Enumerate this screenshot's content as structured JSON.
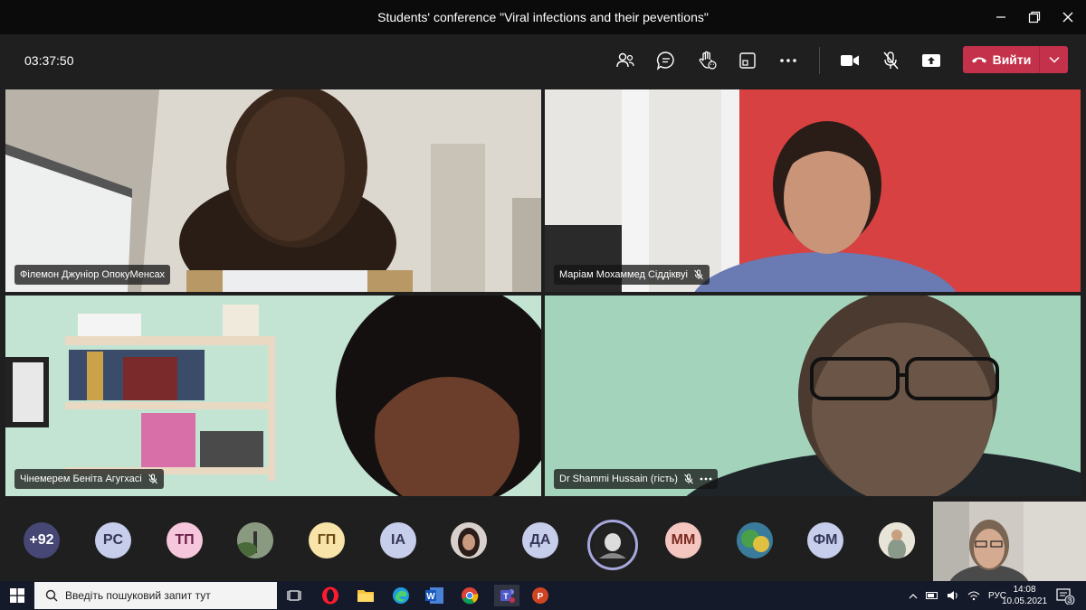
{
  "window": {
    "title": "Students' conference \"Viral infections and their peventions\""
  },
  "toolbar": {
    "timer": "03:37:50",
    "leave_label": "Вийти",
    "accent": "#c4314b"
  },
  "participants": [
    {
      "name": "Філемон Джуніор ОпокуМенсах",
      "muted": false
    },
    {
      "name": "Маріам Мохаммед Сіддіквуі",
      "muted": true
    },
    {
      "name": "Чінемерем Беніта Агугхасі",
      "muted": true
    },
    {
      "name": "Dr Shammi Hussain (гість)",
      "muted": true
    }
  ],
  "strip": {
    "avatars": [
      {
        "label": "+92",
        "kind": "count",
        "color": "#464775"
      },
      {
        "label": "PC",
        "kind": "initials",
        "color": "#c7ceec"
      },
      {
        "label": "ТП",
        "kind": "initials",
        "color": "#f5c6dc"
      },
      {
        "label": "",
        "kind": "photo",
        "color": "#6a7a5a"
      },
      {
        "label": "ГП",
        "kind": "initials",
        "color": "#f8e3a8"
      },
      {
        "label": "IA",
        "kind": "initials",
        "color": "#c7ceec"
      },
      {
        "label": "",
        "kind": "photo",
        "color": "#5a4a46"
      },
      {
        "label": "ДА",
        "kind": "initials",
        "color": "#c7ceec"
      },
      {
        "label": "",
        "kind": "photo-active",
        "color": "#222222"
      },
      {
        "label": "MM",
        "kind": "initials",
        "color": "#f5c6c0"
      },
      {
        "label": "",
        "kind": "photo",
        "color": "#3a6a5a"
      },
      {
        "label": "ФМ",
        "kind": "initials",
        "color": "#c7ceec"
      },
      {
        "label": "",
        "kind": "photo",
        "color": "#c8c2b0"
      }
    ]
  },
  "taskbar": {
    "search_placeholder": "Введіть пошуковий запит тут",
    "lang": "РУС",
    "time": "14:08",
    "date": "10.05.2021",
    "notification_count": "3"
  }
}
